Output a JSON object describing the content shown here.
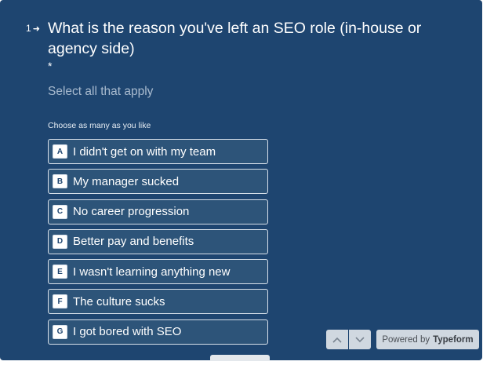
{
  "question": {
    "number": "1",
    "text": "What is the reason you've left an SEO role (in-house or agency side)",
    "required_marker": "*",
    "description": "Select all that apply",
    "hint": "Choose as many as you like"
  },
  "choices": [
    {
      "key": "A",
      "label": "I didn't get on with my team"
    },
    {
      "key": "B",
      "label": "My manager sucked"
    },
    {
      "key": "C",
      "label": "No career progression"
    },
    {
      "key": "D",
      "label": "Better pay and benefits"
    },
    {
      "key": "E",
      "label": "I wasn't learning anything new"
    },
    {
      "key": "F",
      "label": "The culture sucks"
    },
    {
      "key": "G",
      "label": "I got bored with SEO"
    }
  ],
  "footer": {
    "nav_up_icon": "chevron-up-icon",
    "nav_down_icon": "chevron-down-icon",
    "powered_prefix": "Powered by",
    "powered_brand": "Typeform"
  },
  "colors": {
    "background": "#1e4570",
    "choice_bg": "#2d5479",
    "border": "#d7e0ea",
    "description": "#a9bbcf"
  }
}
